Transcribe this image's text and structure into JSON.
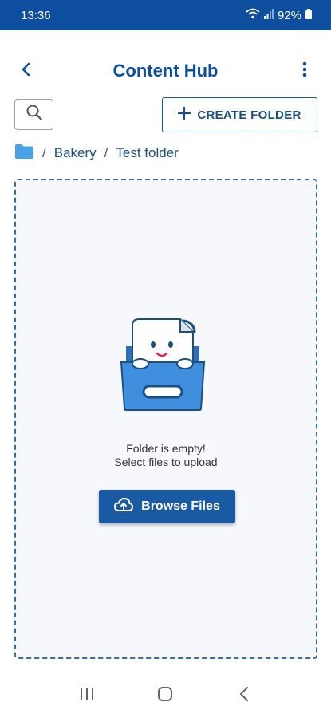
{
  "status_bar": {
    "time": "13:36",
    "battery": "92%",
    "icons": [
      "wifi-icon",
      "signal-icon",
      "battery-icon"
    ]
  },
  "app_bar": {
    "title": "Content Hub",
    "back_icon": "chevron-left-icon",
    "more_icon": "more-vertical-icon"
  },
  "toolbar": {
    "search_icon": "search-icon",
    "create_folder_label": "CREATE FOLDER"
  },
  "breadcrumb": {
    "root_icon": "folder-icon",
    "separator": "/",
    "items": [
      "Bakery",
      "Test folder"
    ]
  },
  "dropzone": {
    "empty_line1": "Folder is empty!",
    "empty_line2": "Select files to upload",
    "browse_label": "Browse Files",
    "browse_icon": "cloud-upload-icon"
  },
  "navigation": {
    "recents_icon": "recents-icon",
    "home_icon": "home-icon",
    "back_icon": "back-icon"
  },
  "colors": {
    "brand": "#0d4f9e",
    "primary_button": "#1a5aa3",
    "folder": "#4aa3e8",
    "illustration_box": "#3f8fde"
  }
}
